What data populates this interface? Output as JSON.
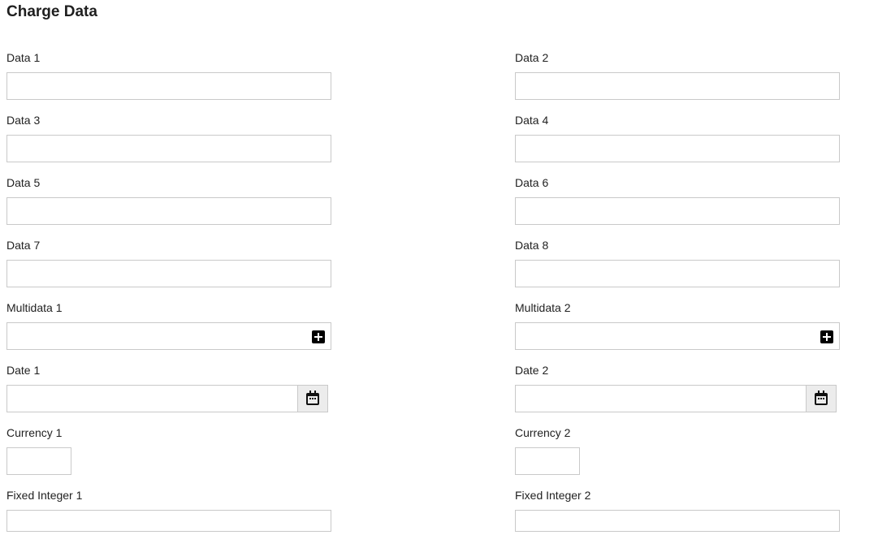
{
  "page": {
    "title": "Charge Data"
  },
  "fields": {
    "data1": {
      "label": "Data 1",
      "value": ""
    },
    "data2": {
      "label": "Data 2",
      "value": ""
    },
    "data3": {
      "label": "Data 3",
      "value": ""
    },
    "data4": {
      "label": "Data 4",
      "value": ""
    },
    "data5": {
      "label": "Data 5",
      "value": ""
    },
    "data6": {
      "label": "Data 6",
      "value": ""
    },
    "data7": {
      "label": "Data 7",
      "value": ""
    },
    "data8": {
      "label": "Data 8",
      "value": ""
    },
    "multidata1": {
      "label": "Multidata 1",
      "value": "",
      "button_icon": "plus-square-icon"
    },
    "multidata2": {
      "label": "Multidata 2",
      "value": "",
      "button_icon": "plus-square-icon"
    },
    "date1": {
      "label": "Date 1",
      "value": "",
      "button_icon": "calendar-icon"
    },
    "date2": {
      "label": "Date 2",
      "value": "",
      "button_icon": "calendar-icon"
    },
    "currency1": {
      "label": "Currency 1",
      "value": ""
    },
    "currency2": {
      "label": "Currency 2",
      "value": ""
    },
    "fixed_integer1": {
      "label": "Fixed Integer 1",
      "value": ""
    },
    "fixed_integer2": {
      "label": "Fixed Integer 2",
      "value": ""
    }
  }
}
